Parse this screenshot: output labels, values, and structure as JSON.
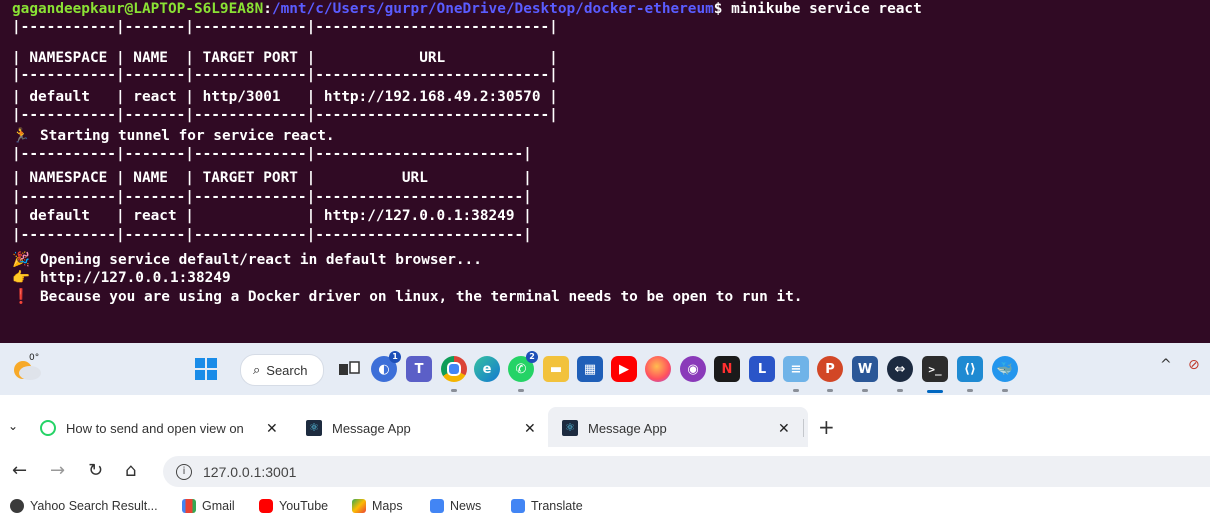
{
  "terminal": {
    "prompt_user": "gagandeepkaur@LAPTOP-S6L9EA8N",
    "prompt_sep": ":",
    "prompt_path": "/mnt/c/Users/gurpr/OneDrive/Desktop/docker-ethereum",
    "prompt_end": "$ ",
    "command": "minikube service react",
    "table1": [
      "|-----------|-------|-------------|---------------------------|",
      "| NAMESPACE | NAME  | TARGET PORT |            URL            |",
      "|-----------|-------|-------------|---------------------------|",
      "| default   | react | http/3001   | http://192.168.49.2:30570 |",
      "|-----------|-------|-------------|---------------------------|"
    ],
    "tunnel_msg": "Starting tunnel for service react.",
    "table2": [
      "|-----------|-------|-------------|------------------------|",
      "| NAMESPACE | NAME  | TARGET PORT |          URL           |",
      "|-----------|-------|-------------|------------------------|",
      "| default   | react |             | http://127.0.0.1:38249 |",
      "|-----------|-------|-------------|------------------------|"
    ],
    "opening_msg": "Opening service default/react in default browser...",
    "url_msg": "http://127.0.0.1:38249",
    "warning_msg": "Because you are using a Docker driver on linux, the terminal needs to be open to run it."
  },
  "taskbar": {
    "weather_temp": "0°",
    "search_label": "Search"
  },
  "browser": {
    "tabs": [
      {
        "label": "How to send and open view on",
        "icon": "whatsapp-icon"
      },
      {
        "label": "Message App",
        "icon": "react-icon"
      },
      {
        "label": "Message App",
        "icon": "react-icon"
      }
    ],
    "new_tab": "+",
    "url": "127.0.0.1:3001",
    "bookmarks": [
      {
        "label": "Yahoo Search Result...",
        "icon": "yahoo-icon"
      },
      {
        "label": "Gmail",
        "icon": "gmail-icon"
      },
      {
        "label": "YouTube",
        "icon": "youtube-icon"
      },
      {
        "label": "Maps",
        "icon": "maps-icon"
      },
      {
        "label": "News",
        "icon": "news-icon"
      },
      {
        "label": "Translate",
        "icon": "translate-icon"
      }
    ]
  },
  "colors": {
    "terminal_bg": "#300a24",
    "prompt_user": "#8ae234",
    "prompt_path": "#5a5cff",
    "taskbar_bg": "#e6ecf5",
    "address_bg": "#eef0f4"
  }
}
